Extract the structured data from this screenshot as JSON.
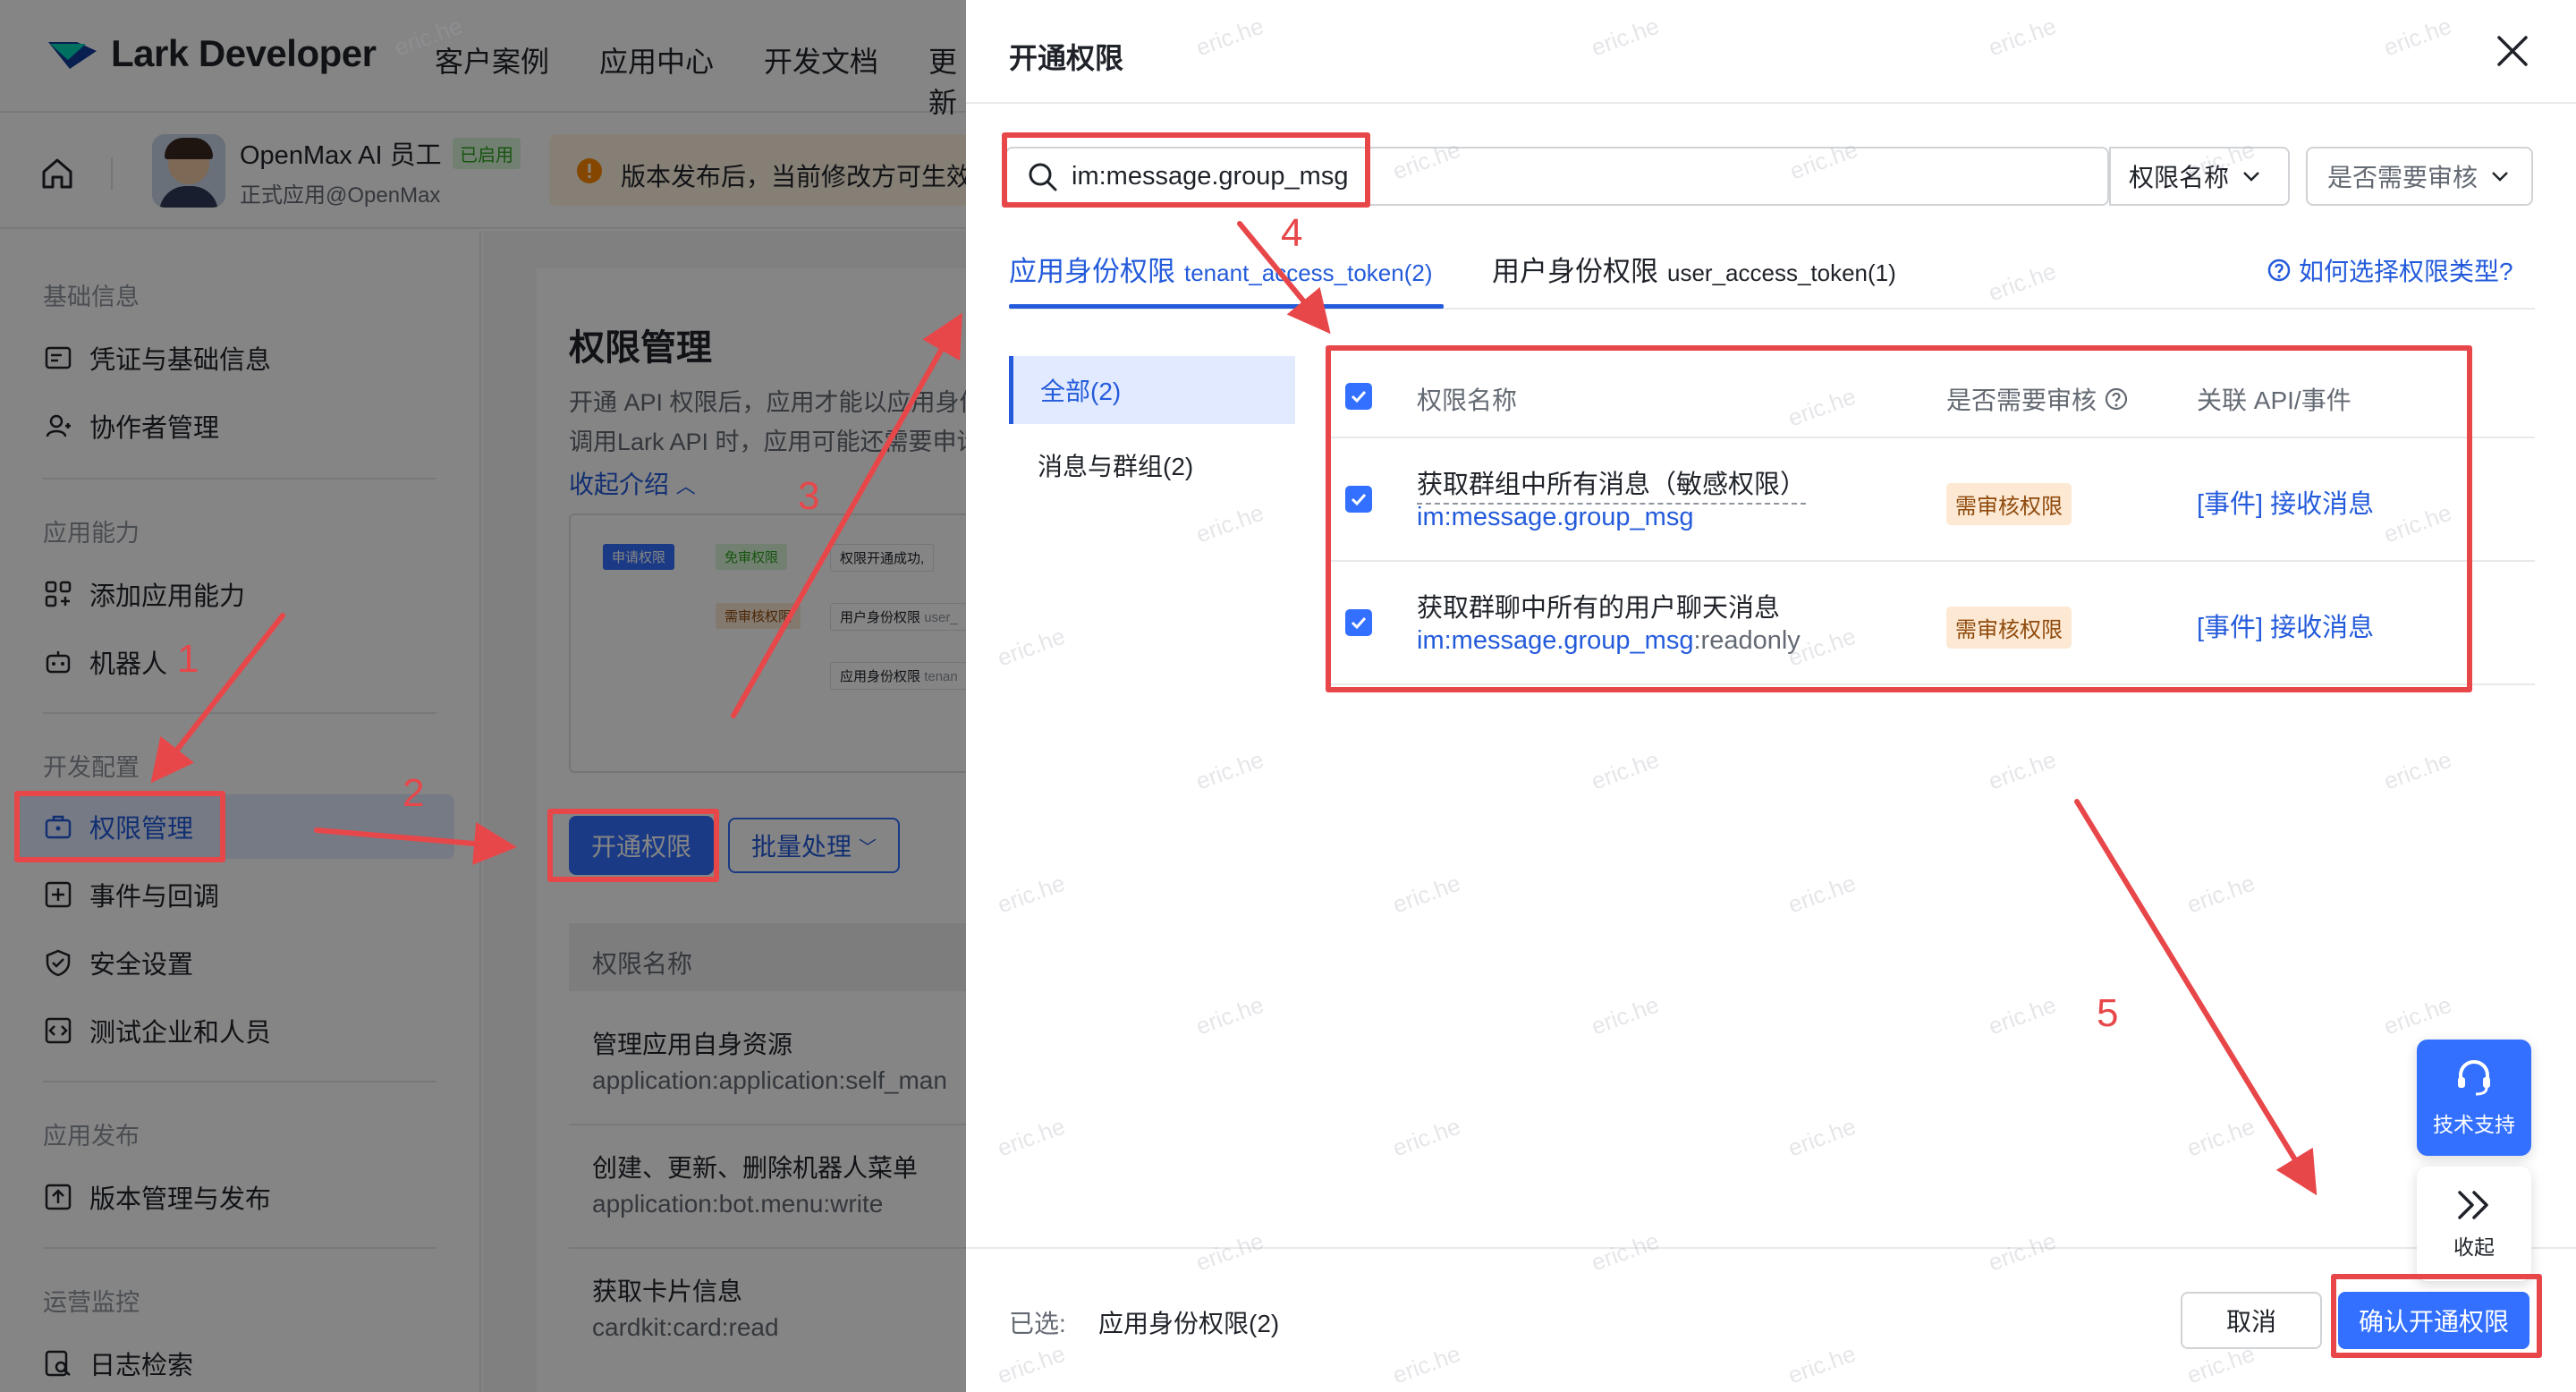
{
  "topnav": {
    "brand": "Lark Developer",
    "items": [
      "客户案例",
      "应用中心",
      "开发文档",
      "更新"
    ]
  },
  "app_header": {
    "name": "OpenMax AI 员工",
    "status": "已启用",
    "subtitle": "正式应用@OpenMax",
    "notice": "版本发布后，当前修改方可生效"
  },
  "sidebar": {
    "groups": [
      {
        "title": "基础信息",
        "items": [
          "凭证与基础信息",
          "协作者管理"
        ]
      },
      {
        "title": "应用能力",
        "items": [
          "添加应用能力",
          "机器人"
        ]
      },
      {
        "title": "开发配置",
        "items": [
          "权限管理",
          "事件与回调",
          "安全设置",
          "测试企业和人员"
        ]
      },
      {
        "title": "应用发布",
        "items": [
          "版本管理与发布"
        ]
      },
      {
        "title": "运营监控",
        "items": [
          "日志检索"
        ]
      }
    ],
    "active": "权限管理"
  },
  "main": {
    "title": "权限管理",
    "desc_line1": "开通 API 权限后，应用才能以应用身份",
    "desc_line2": "调用Lark API 时，应用可能还需要申请",
    "collapse_link": "收起介绍",
    "diagram": {
      "chip1": "申请权限",
      "chip2": "免审权限",
      "chip3": "权限开通成功,",
      "chip4": "需审核权限",
      "chip5": "用户身份权限",
      "chip5_tail": "user_",
      "chip6": "应用身份权限",
      "chip6_tail": "tenan"
    },
    "open_button": "开通权限",
    "batch_button": "批量处理",
    "table_header": "权限名称",
    "rows": [
      {
        "name": "管理应用自身资源",
        "code": "application:application:self_man"
      },
      {
        "name": "创建、更新、删除机器人菜单",
        "code": "application:bot.menu:write"
      },
      {
        "name": "获取卡片信息",
        "code": "cardkit:card:read"
      }
    ]
  },
  "drawer": {
    "title": "开通权限",
    "search_value": "im:message.group_msg",
    "filter_name": "权限名称",
    "filter_review": "是否需要审核",
    "tabs": [
      {
        "label": "应用身份权限",
        "token": "tenant_access_token(2)"
      },
      {
        "label": "用户身份权限",
        "token": "user_access_token(1)"
      }
    ],
    "help_link": "如何选择权限类型?",
    "categories": [
      "全部(2)",
      "消息与群组(2)"
    ],
    "columns": [
      "权限名称",
      "是否需要审核",
      "关联 API/事件"
    ],
    "permissions": [
      {
        "name": "获取群组中所有消息（敏感权限）",
        "code_main": "im:message.group_msg",
        "code_suffix": "",
        "review": "需审核权限",
        "event": "[事件] 接收消息"
      },
      {
        "name": "获取群聊中所有的用户聊天消息",
        "code_main": "im:message.group_msg",
        "code_suffix": ":readonly",
        "review": "需审核权限",
        "event": "[事件] 接收消息"
      }
    ],
    "footer": {
      "selected_label": "已选:",
      "selected_value": "应用身份权限(2)",
      "cancel": "取消",
      "confirm": "确认开通权限"
    },
    "float": {
      "support": "技术支持",
      "collapse": "收起"
    }
  },
  "annotations": [
    "1",
    "2",
    "3",
    "4",
    "5"
  ],
  "watermark": "eric.he",
  "colors": {
    "primary": "#3370ff",
    "link": "#245bdb",
    "annotation": "#e8474a",
    "review_tag_bg": "#fde9d3"
  }
}
